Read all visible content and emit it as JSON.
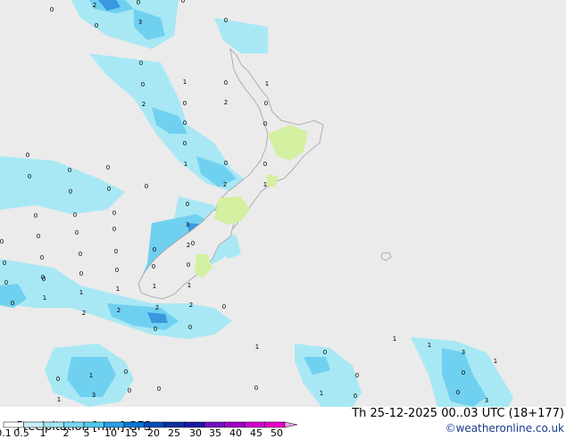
{
  "header": {
    "product": "Precipitation [mm]",
    "model": "GFS",
    "valid_time": "Th 25-12-2025 00..03 UTC (18+177)",
    "credit": "©weatheronline.co.uk"
  },
  "legend": {
    "labels": [
      "0.1",
      "0.5",
      "1",
      "2",
      "5",
      "10",
      "15",
      "20",
      "25",
      "30",
      "35",
      "40",
      "45",
      "50"
    ],
    "colors": [
      "#ffffff",
      "#c8f0f8",
      "#a0e4f8",
      "#78d8f8",
      "#50c8f0",
      "#28a0e8",
      "#0878d8",
      "#0050b8",
      "#0830a0",
      "#1818a8",
      "#7010c0",
      "#a000c8",
      "#d000d0",
      "#e800c8",
      "#f0a0f0"
    ]
  },
  "map": {
    "colors": {
      "sea": "#ebebeb",
      "land": "#ebebeb",
      "land_green": "#d2f0a0",
      "coast": "#a0a0a0"
    },
    "values": [
      "0",
      "2",
      "0",
      "0",
      "0",
      "3",
      "0",
      "0",
      "0",
      "1",
      "0",
      "1",
      "2",
      "0",
      "2",
      "0",
      "0",
      "0",
      "0",
      "1",
      "0",
      "0",
      "0",
      "0",
      "2",
      "1",
      "0",
      "0",
      "0",
      "0",
      "0",
      "0",
      "0",
      "0",
      "0",
      "0",
      "0",
      "0",
      "0",
      "0",
      "0",
      "0",
      "0",
      "0",
      "0",
      "0",
      "0",
      "0",
      "0",
      "0",
      "3",
      "2",
      "0",
      "0",
      "1",
      "1",
      "1",
      "1",
      "1",
      "2",
      "2",
      "2",
      "0",
      "2",
      "0",
      "0",
      "1",
      "1",
      "1",
      "3",
      "0",
      "0",
      "0",
      "1",
      "0",
      "1",
      "0",
      "1",
      "3",
      "0",
      "0",
      "0",
      "0",
      "1",
      "0",
      "0",
      "3"
    ]
  }
}
